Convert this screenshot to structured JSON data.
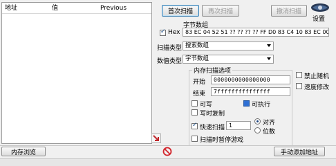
{
  "results_list": {
    "columns": [
      "地址",
      "值",
      "Previous"
    ]
  },
  "scan_buttons": {
    "first_scan": "首次扫描",
    "next_scan": "再次扫描",
    "undo_scan": "撤消扫描"
  },
  "settings_label": "设置",
  "value_section": {
    "label": "字节数组",
    "hex_label": "Hex",
    "hex_checked": true,
    "value": "83 EC 04 52 51 ?? ?? ?? ?? FF D0 83 C4 10 83 EC 0C"
  },
  "scan_type": {
    "label": "扫描类型",
    "selected": "搜索数组"
  },
  "value_type": {
    "label": "数值类型",
    "selected": "字节数组"
  },
  "memory_options": {
    "title": "内存扫描选项",
    "start_label": "开始",
    "start_value": "0000000000000000",
    "end_label": "结束",
    "end_value": "7fffffffffffffff",
    "writable_label": "可写",
    "writable_checked": false,
    "executable_label": "可执行",
    "executable_checked": true,
    "copy_on_write_label": "写时复制",
    "copy_on_write_checked": false,
    "fast_scan_label": "快速扫描",
    "fast_scan_checked": true,
    "fast_scan_value": "1",
    "align_label": "对齐",
    "align_checked": true,
    "last_digits_label": "位数",
    "last_digits_checked": false,
    "pause_game_label": "扫描时暂停游戏",
    "pause_game_checked": false
  },
  "extra_options": {
    "disable_random_label": "禁止随机",
    "disable_random_checked": false,
    "speedhack_label": "速度修改",
    "speedhack_checked": false
  },
  "bottom": {
    "memory_view_button": "内存浏览",
    "add_address_button": "手动添加地址"
  }
}
